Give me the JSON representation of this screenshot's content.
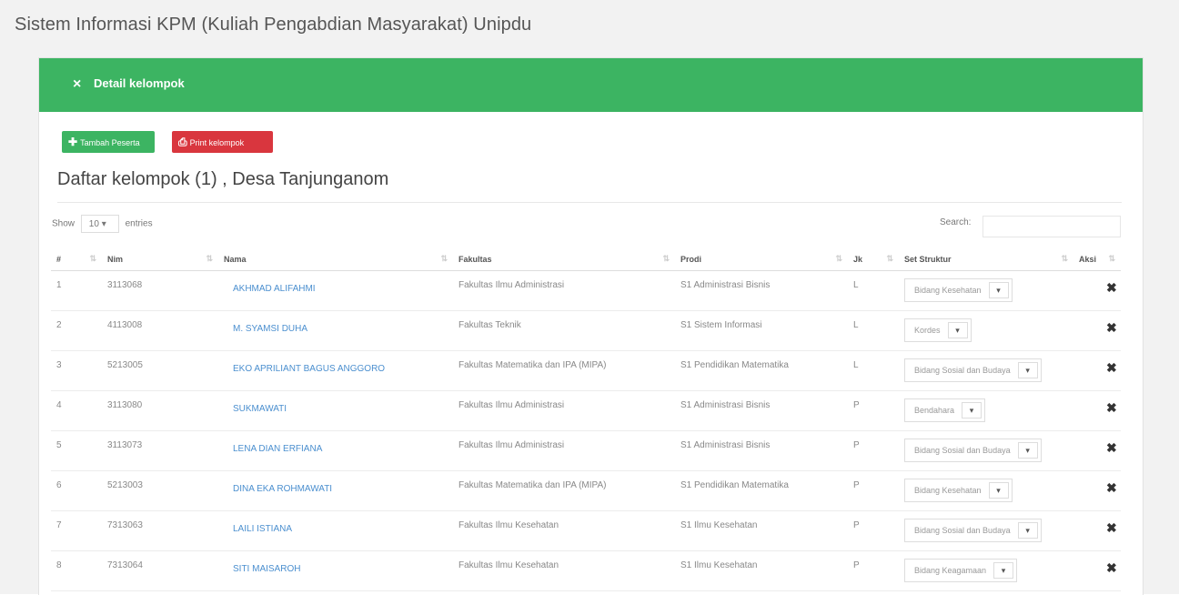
{
  "app": {
    "title": "Sistem Informasi KPM (Kuliah Pengabdian Masyarakat) Unipdu"
  },
  "panel": {
    "close_icon": "×",
    "title": "Detail kelompok",
    "header_color": "#3cb462"
  },
  "toolbar": {
    "add_icon": "✚",
    "add_label": "Tambah Peserta",
    "print_icon": "⎙",
    "print_label": "Print kelompok"
  },
  "list": {
    "title": "Daftar kelompok (1) , Desa Tanjunganom"
  },
  "table_controls": {
    "show_label": "Show",
    "page_size": "10",
    "entries_label": "entries",
    "search_label": "Search:"
  },
  "table": {
    "headers": [
      "#",
      "Nim",
      "Nama",
      "Fakultas",
      "Prodi",
      "Jk",
      "Set Struktur",
      "Aksi"
    ],
    "rows": [
      {
        "no": "1",
        "nim": "3113068",
        "nama": "AKHMAD ALIFAHMI",
        "fakultas": "Fakultas Ilmu Administrasi",
        "prodi": "S1 Administrasi Bisnis",
        "jk": "L",
        "struktur": "Bidang Kesehatan"
      },
      {
        "no": "2",
        "nim": "4113008",
        "nama": "M. SYAMSI DUHA",
        "fakultas": "Fakultas Teknik",
        "prodi": "S1 Sistem Informasi",
        "jk": "L",
        "struktur": "Kordes"
      },
      {
        "no": "3",
        "nim": "5213005",
        "nama": "EKO APRILIANT BAGUS ANGGORO",
        "fakultas": "Fakultas Matematika dan IPA (MIPA)",
        "prodi": "S1 Pendidikan Matematika",
        "jk": "L",
        "struktur": "Bidang Sosial dan Budaya"
      },
      {
        "no": "4",
        "nim": "3113080",
        "nama": "SUKMAWATI",
        "fakultas": "Fakultas Ilmu Administrasi",
        "prodi": "S1 Administrasi Bisnis",
        "jk": "P",
        "struktur": "Bendahara"
      },
      {
        "no": "5",
        "nim": "3113073",
        "nama": "LENA DIAN ERFIANA",
        "fakultas": "Fakultas Ilmu Administrasi",
        "prodi": "S1 Administrasi Bisnis",
        "jk": "P",
        "struktur": "Bidang Sosial dan Budaya"
      },
      {
        "no": "6",
        "nim": "5213003",
        "nama": "DINA EKA ROHMAWATI",
        "fakultas": "Fakultas Matematika dan IPA (MIPA)",
        "prodi": "S1 Pendidikan Matematika",
        "jk": "P",
        "struktur": "Bidang Kesehatan"
      },
      {
        "no": "7",
        "nim": "7313063",
        "nama": "LAILI ISTIANA",
        "fakultas": "Fakultas Ilmu Kesehatan",
        "prodi": "S1 Ilmu Kesehatan",
        "jk": "P",
        "struktur": "Bidang Sosial dan Budaya"
      },
      {
        "no": "8",
        "nim": "7313064",
        "nama": "SITI MAISAROH",
        "fakultas": "Fakultas Ilmu Kesehatan",
        "prodi": "S1 Ilmu Kesehatan",
        "jk": "P",
        "struktur": "Bidang Keagamaan"
      }
    ],
    "delete_icon": "✖",
    "caret_icon": "▾"
  }
}
